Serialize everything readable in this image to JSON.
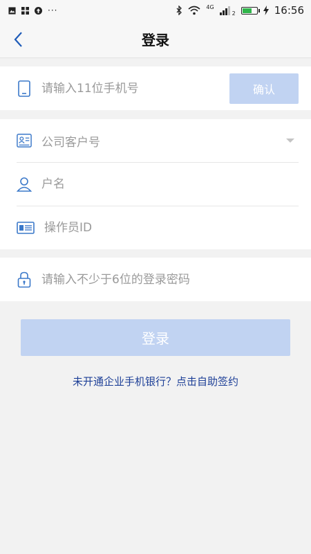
{
  "status_bar": {
    "dots": "···",
    "network": "4G",
    "signal_sub": "2",
    "time": "16:56",
    "battery_color": "#2fb54a"
  },
  "nav": {
    "back_icon": "chevron-left-icon",
    "title": "登录"
  },
  "phone": {
    "icon": "mobile-phone-icon",
    "placeholder": "请输入11位手机号",
    "value": "",
    "confirm_label": "确认"
  },
  "account": {
    "company": {
      "icon": "id-card-icon",
      "placeholder": "公司客户号",
      "arrow_icon": "dropdown-arrow-icon"
    },
    "username": {
      "icon": "user-icon",
      "placeholder": "户名",
      "value": ""
    },
    "operator": {
      "icon": "badge-card-icon",
      "placeholder": "操作员ID",
      "value": ""
    }
  },
  "password": {
    "icon": "lock-icon",
    "placeholder": "请输入不少于6位的登录密码",
    "value": ""
  },
  "actions": {
    "login_label": "登录",
    "signup_link": "未开通企业手机银行？点击自助签约"
  },
  "colors": {
    "accent": "#3a78c9",
    "button_disabled": "#c1d3f2",
    "link": "#1d3f97",
    "background": "#f2f2f2"
  }
}
